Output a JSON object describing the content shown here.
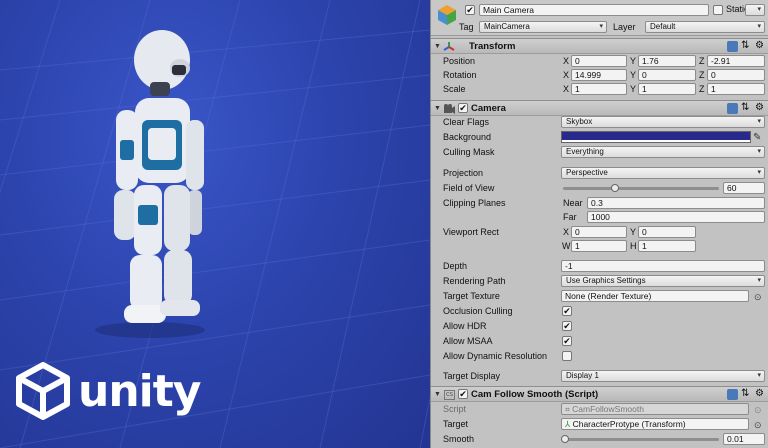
{
  "scene": {
    "brand_word": "unity"
  },
  "gameobject": {
    "enabled": true,
    "name": "Main Camera",
    "static_label": "Static",
    "tag_label": "Tag",
    "tag_value": "MainCamera",
    "layer_label": "Layer",
    "layer_value": "Default"
  },
  "transform": {
    "title": "Transform",
    "position_label": "Position",
    "position": {
      "x": "0",
      "y": "1.76",
      "z": "-2.91"
    },
    "rotation_label": "Rotation",
    "rotation": {
      "x": "14.999",
      "y": "0",
      "z": "0"
    },
    "scale_label": "Scale",
    "scale": {
      "x": "1",
      "y": "1",
      "z": "1"
    },
    "axis_x": "X",
    "axis_y": "Y",
    "axis_z": "Z"
  },
  "camera": {
    "title": "Camera",
    "enabled": true,
    "clear_flags_label": "Clear Flags",
    "clear_flags_value": "Skybox",
    "background_label": "Background",
    "background_color": "#28298a",
    "culling_mask_label": "Culling Mask",
    "culling_mask_value": "Everything",
    "projection_label": "Projection",
    "projection_value": "Perspective",
    "fov_label": "Field of View",
    "fov_value": "60",
    "fov_fraction": 0.33,
    "clipping_label": "Clipping Planes",
    "near_label": "Near",
    "near_value": "0.3",
    "far_label": "Far",
    "far_value": "1000",
    "viewport_label": "Viewport Rect",
    "viewport": {
      "x": "0",
      "y": "0",
      "w": "1",
      "h": "1"
    },
    "axis_w": "W",
    "axis_h": "H",
    "depth_label": "Depth",
    "depth_value": "-1",
    "rendering_path_label": "Rendering Path",
    "rendering_path_value": "Use Graphics Settings",
    "target_texture_label": "Target Texture",
    "target_texture_value": "None (Render Texture)",
    "occlusion_label": "Occlusion Culling",
    "occlusion_checked": "✔",
    "hdr_label": "Allow HDR",
    "hdr_checked": "✔",
    "msaa_label": "Allow MSAA",
    "msaa_checked": "✔",
    "dyn_res_label": "Allow Dynamic Resolution",
    "dyn_res_checked": "",
    "target_display_label": "Target Display",
    "target_display_value": "Display 1"
  },
  "cam_follow": {
    "title": "Cam Follow Smooth (Script)",
    "enabled": true,
    "script_label": "Script",
    "script_value": "CamFollowSmooth",
    "target_label": "Target",
    "target_value": "CharacterProtype (Transform)",
    "smooth_label": "Smooth",
    "smooth_value": "0.01",
    "smooth_fraction": 0.0
  },
  "colors": {
    "inspector_bg": "#c2c2c2",
    "scene_bg": "#2c44ad",
    "camera_background": "#28298a"
  }
}
